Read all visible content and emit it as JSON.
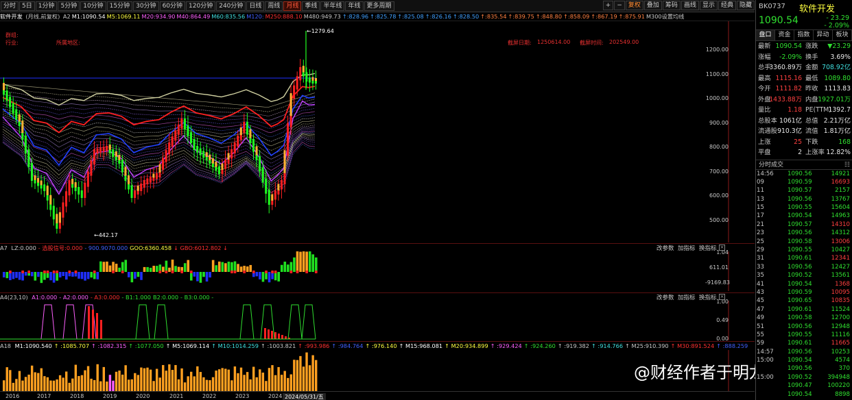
{
  "toolbar": {
    "periods": [
      "分时",
      "5日",
      "1分钟",
      "5分钟",
      "10分钟",
      "15分钟",
      "30分钟",
      "60分钟",
      "120分钟",
      "240分钟",
      "日线",
      "周线",
      "月线",
      "季线",
      "半年线",
      "年线",
      "更多周期"
    ],
    "active_period": "月线",
    "right_buttons": [
      "+",
      "−",
      "复权",
      "叠加",
      "筹码",
      "画线",
      "显示",
      "经典",
      "隐藏"
    ],
    "selected_right": "复权"
  },
  "ma_strip": {
    "name": "软件开发",
    "mode": "(月线,前复权)",
    "items": [
      {
        "text": "A2",
        "color": "#c8c8c8"
      },
      {
        "text": "M1:1090.54",
        "color": "#ffffff"
      },
      {
        "text": "M5:1069.11",
        "color": "#ffff40"
      },
      {
        "text": "M20:934.90",
        "color": "#ff60ff"
      },
      {
        "text": "M40:864.49",
        "color": "#ff60ff"
      },
      {
        "text": "M60:835.56",
        "color": "#40e0e0"
      },
      {
        "text": "M120:",
        "color": "#4060ff"
      },
      {
        "text": "M250:888.10",
        "color": "#ff3030"
      },
      {
        "text": "M480:949.73",
        "color": "#c8c8c8"
      },
      {
        "text": "↑:828.96",
        "color": "#40a0ff"
      },
      {
        "text": "↑:825.78",
        "color": "#40a0ff"
      },
      {
        "text": "↑:825.08",
        "color": "#40a0ff"
      },
      {
        "text": "↑:826.16",
        "color": "#40a0ff"
      },
      {
        "text": "↑:828.50",
        "color": "#40a0ff"
      },
      {
        "text": "↑:835.54",
        "color": "#ff8040"
      },
      {
        "text": "↑:839.75",
        "color": "#ff8040"
      },
      {
        "text": "↑:848.80",
        "color": "#ff8040"
      },
      {
        "text": "↑:858.09",
        "color": "#ff8040"
      },
      {
        "text": "↑:867.19",
        "color": "#ff8040"
      },
      {
        "text": "↑:875.91",
        "color": "#ff8040"
      },
      {
        "text": "M300设置均线",
        "color": "#c8c8c8"
      }
    ]
  },
  "main_chart": {
    "labels": {
      "sector": "群组:",
      "industry": "行业:",
      "region": "所属地区:",
      "date_label": "截屏日期:",
      "date_value": "1250614.00",
      "time_label": "截屏时间:",
      "time_value": "202549.00"
    },
    "high_marker": "1279.64",
    "low_marker": "442.17",
    "y_axis": [
      "1200.00",
      "1100.00",
      "1000.00",
      "900.00",
      "800.00",
      "700.00",
      "600.00",
      "500.00"
    ]
  },
  "panel_a7": {
    "title": "A7",
    "items": [
      {
        "text": "LZ:0.000",
        "color": "#c8c8c8"
      },
      {
        "text": "- 选股信号:0.000",
        "color": "#ff3030"
      },
      {
        "text": "- 900.9070.000",
        "color": "#4060ff"
      },
      {
        "text": "GOO:6360.458",
        "color": "#ffff40"
      },
      {
        "text": "↓ GBO:6012.802 ↓",
        "color": "#ff3030"
      }
    ],
    "y_axis": [
      "1.04",
      "611.01",
      "-9169.83"
    ]
  },
  "panel_a4": {
    "title": "A4(23,10)",
    "items": [
      {
        "text": "A1:0.000",
        "color": "#ff60ff"
      },
      {
        "text": "- A2:0.000",
        "color": "#ff60ff"
      },
      {
        "text": "- A3:0.000",
        "color": "#ff3030"
      },
      {
        "text": "- B1:1.000",
        "color": "#30e030"
      },
      {
        "text": "B2:0.000",
        "color": "#30e030"
      },
      {
        "text": "- B3:0.000 -",
        "color": "#30e030"
      }
    ],
    "y_axis": [
      "1.00",
      "0.49",
      "0.00"
    ]
  },
  "panel_a18": {
    "title": "A18",
    "items": [
      {
        "text": "M1:1090.540",
        "color": "#ffffff"
      },
      {
        "text": "↑ :1085.707",
        "color": "#ffff40"
      },
      {
        "text": "↑ :1082.315",
        "color": "#ff60ff"
      },
      {
        "text": "↑ :1077.050",
        "color": "#30e030"
      },
      {
        "text": "↑ M5:1069.114",
        "color": "#ffffff"
      },
      {
        "text": "↑ M10:1014.259",
        "color": "#40e0e0"
      },
      {
        "text": "↑ :1003.821",
        "color": "#c8c8c8"
      },
      {
        "text": "↑ :993.986",
        "color": "#ff3030"
      },
      {
        "text": "↑ :984.764",
        "color": "#4060ff"
      },
      {
        "text": "↑ :976.140",
        "color": "#ffff40"
      },
      {
        "text": "↑ M15:968.081",
        "color": "#ffffff"
      },
      {
        "text": "↑ M20:934.899",
        "color": "#ffff40"
      },
      {
        "text": "↑ :929.424",
        "color": "#ff60ff"
      },
      {
        "text": "↑ :924.260",
        "color": "#30e030"
      },
      {
        "text": "↑ :919.382",
        "color": "#c8c8c8"
      },
      {
        "text": "↑ :914.766",
        "color": "#40e0e0"
      },
      {
        "text": "↑ M25:910.390",
        "color": "#c8c8c8"
      },
      {
        "text": "↑ M30:891.524",
        "color": "#ff3030"
      },
      {
        "text": "↑ :888.259",
        "color": "#4060ff"
      }
    ]
  },
  "panel_buttons": [
    "改参数",
    "加指标",
    "换指标"
  ],
  "close_glyph": "×",
  "dates": [
    "2016",
    "2017",
    "2018",
    "2019",
    "2020",
    "2021",
    "2022",
    "2023",
    "2024",
    "2024/05/31/五"
  ],
  "watermark": "@财经作者于明龙",
  "quote": {
    "code": "BK0737",
    "name": "软件开发",
    "price": "1090.54",
    "change": "- 23.29",
    "change_pct": "- 2.09%",
    "tabs": [
      "盘口",
      "资金",
      "指数",
      "异动",
      "板块"
    ],
    "rows": [
      {
        "a": "最新",
        "b": "1090.54",
        "bc": "green",
        "c": "涨跌",
        "d": "▼23.29",
        "dc": "green"
      },
      {
        "a": "涨幅",
        "b": "-2.09%",
        "bc": "green",
        "c": "换手",
        "d": "3.69%",
        "dc": "white"
      },
      {
        "a": "总手",
        "b": "3360.89万",
        "bc": "white",
        "c": "金额",
        "d": "708.92亿",
        "dc": "cyan"
      },
      {
        "a": "最高",
        "b": "1115.16",
        "bc": "red",
        "c": "最低",
        "d": "1089.80",
        "dc": "green"
      },
      {
        "a": "今开",
        "b": "1111.82",
        "bc": "red",
        "c": "昨收",
        "d": "1113.83",
        "dc": "white"
      },
      {
        "a": "外盘",
        "b": "1433.88万",
        "bc": "red",
        "c": "内盘",
        "d": "1927.01万",
        "dc": "green"
      },
      {
        "a": "量比",
        "b": "1.18",
        "bc": "red",
        "c": "PE(TTM)",
        "d": "1392.7",
        "dc": "white"
      },
      {
        "a": "总股本",
        "b": "1061亿",
        "bc": "white",
        "c": "总值",
        "d": "2.21万亿",
        "dc": "white"
      },
      {
        "a": "流通股",
        "b": "910.3亿",
        "bc": "white",
        "c": "流值",
        "d": "1.81万亿",
        "dc": "white"
      },
      {
        "a": "上涨",
        "b": "25",
        "bc": "red",
        "c": "下跌",
        "d": "168",
        "dc": "green"
      },
      {
        "a": "平盘",
        "b": "2",
        "bc": "white",
        "c": "上涨率",
        "d": "12.82%",
        "dc": "white"
      }
    ],
    "ticks_title": "分时成交",
    "ticks": [
      {
        "t": "14:56",
        "p": "1090.56",
        "v": "14921",
        "vc": "green"
      },
      {
        "t": "09",
        "p": "1090.59",
        "v": "16693",
        "vc": "red"
      },
      {
        "t": "11",
        "p": "1090.57",
        "v": "2157",
        "vc": "green"
      },
      {
        "t": "13",
        "p": "1090.56",
        "v": "13767",
        "vc": "green"
      },
      {
        "t": "15",
        "p": "1090.55",
        "v": "15604",
        "vc": "green"
      },
      {
        "t": "17",
        "p": "1090.54",
        "v": "14963",
        "vc": "green"
      },
      {
        "t": "21",
        "p": "1090.57",
        "v": "14310",
        "vc": "red"
      },
      {
        "t": "23",
        "p": "1090.56",
        "v": "14312",
        "vc": "green"
      },
      {
        "t": "25",
        "p": "1090.58",
        "v": "13006",
        "vc": "red"
      },
      {
        "t": "29",
        "p": "1090.55",
        "v": "10427",
        "vc": "green"
      },
      {
        "t": "31",
        "p": "1090.61",
        "v": "12341",
        "vc": "red"
      },
      {
        "t": "33",
        "p": "1090.56",
        "v": "12427",
        "vc": "green"
      },
      {
        "t": "35",
        "p": "1090.52",
        "v": "13561",
        "vc": "green"
      },
      {
        "t": "41",
        "p": "1090.54",
        "v": "1368",
        "vc": "red"
      },
      {
        "t": "43",
        "p": "1090.59",
        "v": "10095",
        "vc": "red"
      },
      {
        "t": "45",
        "p": "1090.65",
        "v": "10835",
        "vc": "red"
      },
      {
        "t": "47",
        "p": "1090.61",
        "v": "11524",
        "vc": "green"
      },
      {
        "t": "49",
        "p": "1090.58",
        "v": "12700",
        "vc": "green"
      },
      {
        "t": "51",
        "p": "1090.56",
        "v": "12948",
        "vc": "green"
      },
      {
        "t": "55",
        "p": "1090.55",
        "v": "11116",
        "vc": "green"
      },
      {
        "t": "59",
        "p": "1090.61",
        "v": "11665",
        "vc": "red"
      },
      {
        "t": "14:57",
        "p": "1090.56",
        "v": "10253",
        "vc": "green"
      },
      {
        "t": "15:00",
        "p": "1090.54",
        "v": "4574",
        "vc": "green"
      },
      {
        "t": "",
        "p": "1090.56",
        "v": "370",
        "vc": "green"
      },
      {
        "t": "15:00",
        "p": "1090.52",
        "v": "394948",
        "vc": "green"
      },
      {
        "t": "",
        "p": "1090.47",
        "v": "100220",
        "vc": "green"
      },
      {
        "t": "",
        "p": "1090.54",
        "v": "8898",
        "vc": "green"
      }
    ]
  }
}
